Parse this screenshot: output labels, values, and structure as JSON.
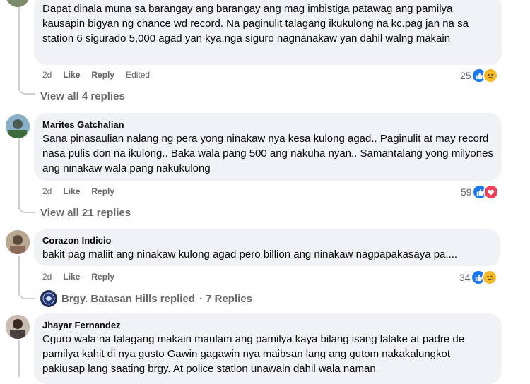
{
  "comments": [
    {
      "author": "",
      "text": "Dapat dinala muna sa barangay ang barangay ang mag imbistiga patawag ang pamilya kausapin bigyan ng chance wd record. Na paginulit talagang ikukulong na kc.pag jan na sa station 6 sigurado 5,000 agad yan kya.nga siguro nagnanakaw yan dahil walng makain",
      "age": "2d",
      "like_label": "Like",
      "reply_label": "Reply",
      "edited_label": "Edited",
      "reaction_count": "25",
      "reactions": [
        "like-icon",
        "sad-icon"
      ],
      "view_replies": "View all 4 replies"
    },
    {
      "author": "Marites Gatchalian",
      "text": "Sana pinasaulian nalang ng pera yong ninakaw nya kesa kulong agad.. Paginulit at may record nasa pulis don na ikulong.. Baka wala pang 500 ang nakuha nyan.. Samantalang yong milyones ang ninakaw wala pang nakukulong",
      "age": "2d",
      "like_label": "Like",
      "reply_label": "Reply",
      "reaction_count": "59",
      "reactions": [
        "like-icon",
        "love-icon"
      ],
      "view_replies": "View all 21 replies"
    },
    {
      "author": "Corazon Indicio",
      "text": "bakit pag maliit ang ninakaw kulong agad pero billion ang ninakaw nagpapakasaya pa....",
      "age": "2d",
      "like_label": "Like",
      "reply_label": "Reply",
      "reaction_count": "34",
      "reactions": [
        "like-icon",
        "sad-icon"
      ],
      "replied_page": "Brgy. Batasan Hills replied",
      "replied_count": "· 7 Replies"
    },
    {
      "author": "Jhayar Fernandez",
      "text": "Cguro wala na talagang makain maulam ang pamilya kaya bilang isang lalake at padre de pamilya kahit di nya gusto Gawin gagawin nya maibsan lang ang gutom nakakalungkot pakiusap lang saating brgy. At police station unawain dahil wala naman"
    }
  ],
  "colors": {
    "bubble": "#f0f2f5",
    "secondary_text": "#65676b",
    "like_blue": "#1877f2",
    "love_red": "#f33e58",
    "sad_yellow": "#f7b928"
  }
}
